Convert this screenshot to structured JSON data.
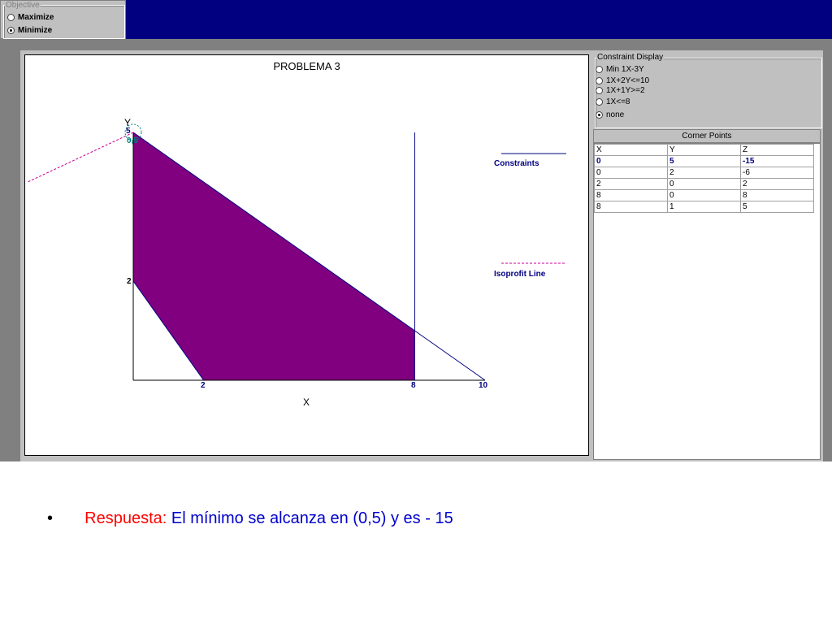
{
  "objective": {
    "title": "Objective",
    "options": [
      "Maximize",
      "Minimize"
    ],
    "selected": "Minimize"
  },
  "graph": {
    "title": "PROBLEMA 3",
    "x_label": "X",
    "y_label": "Y",
    "x_ticks": [
      "2",
      "8",
      "10"
    ],
    "y_ticks": [
      "5",
      "2"
    ],
    "point_label": "0,5",
    "legend": {
      "constraints": "Constraints",
      "isoprofit": "Isoprofit Line"
    },
    "colors": {
      "feasible_region": "#800080",
      "constraint_line": "#000080",
      "isoprofit_line": "#cc0099"
    }
  },
  "chart_data": {
    "type": "area",
    "title": "PROBLEMA 3",
    "xlabel": "X",
    "ylabel": "Y",
    "xlim": [
      0,
      10
    ],
    "ylim": [
      0,
      5
    ],
    "feasible_region": [
      [
        0,
        5
      ],
      [
        0,
        2
      ],
      [
        2,
        0
      ],
      [
        8,
        0
      ],
      [
        8,
        1
      ]
    ],
    "constraint_lines": [
      {
        "name": "1X+2Y<=10",
        "points": [
          [
            0,
            5
          ],
          [
            10,
            0
          ]
        ]
      },
      {
        "name": "1X+1Y>=2",
        "points": [
          [
            0,
            2
          ],
          [
            2,
            0
          ]
        ]
      },
      {
        "name": "1X<=8",
        "points": [
          [
            8,
            0
          ],
          [
            8,
            5
          ]
        ]
      }
    ],
    "isoprofit": {
      "name": "Min 1X-3Y",
      "value": -15,
      "through": [
        0,
        5
      ]
    }
  },
  "constraint_display": {
    "title": "Constraint Display",
    "options": [
      "Min 1X-3Y",
      "1X+2Y<=10",
      "1X+1Y>=2",
      "1X<=8",
      "none"
    ],
    "selected": "none"
  },
  "corner_points": {
    "title": "Corner Points",
    "headers": [
      "X",
      "Y",
      "Z"
    ],
    "rows": [
      [
        "0",
        "5",
        "-15"
      ],
      [
        "0",
        "2",
        "-6"
      ],
      [
        "2",
        "0",
        "2"
      ],
      [
        "8",
        "0",
        "8"
      ],
      [
        "8",
        "1",
        "5"
      ]
    ],
    "selected_row": 0
  },
  "note": {
    "bullet": "•",
    "label": "Respuesta:",
    "text": " El mínimo se alcanza en (0,5) y es - 15",
    "label_color": "#ff0000",
    "text_color": "#0000cc"
  }
}
